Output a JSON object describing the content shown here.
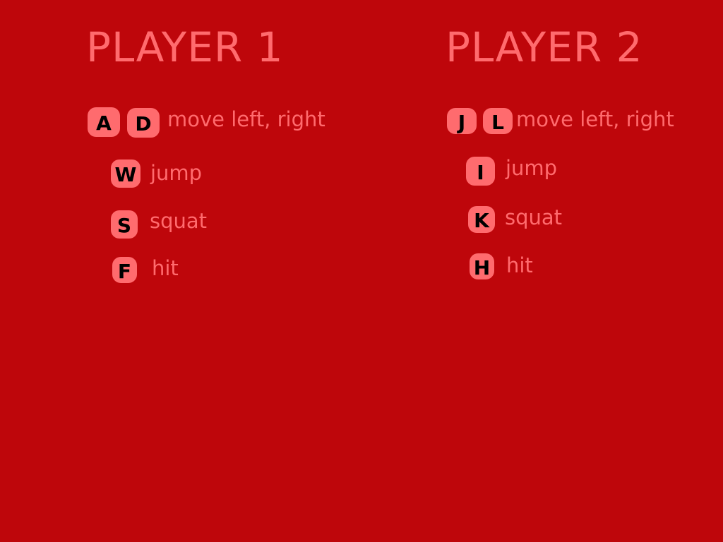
{
  "colors": {
    "background": "#be060b",
    "text": "#ff6b6e",
    "key_fill": "#ff6b6e",
    "key_text": "#000000"
  },
  "player1": {
    "title": "PLAYER 1",
    "controls": [
      {
        "keys": [
          "A",
          "D"
        ],
        "action": "move left, right"
      },
      {
        "keys": [
          "W"
        ],
        "action": "jump"
      },
      {
        "keys": [
          "S"
        ],
        "action": "squat"
      },
      {
        "keys": [
          "F"
        ],
        "action": "hit"
      }
    ]
  },
  "player2": {
    "title": "PLAYER 2",
    "controls": [
      {
        "keys": [
          "J",
          "L"
        ],
        "action": "move left, right"
      },
      {
        "keys": [
          "I"
        ],
        "action": "jump"
      },
      {
        "keys": [
          "K"
        ],
        "action": "squat"
      },
      {
        "keys": [
          "H"
        ],
        "action": "hit"
      }
    ]
  }
}
